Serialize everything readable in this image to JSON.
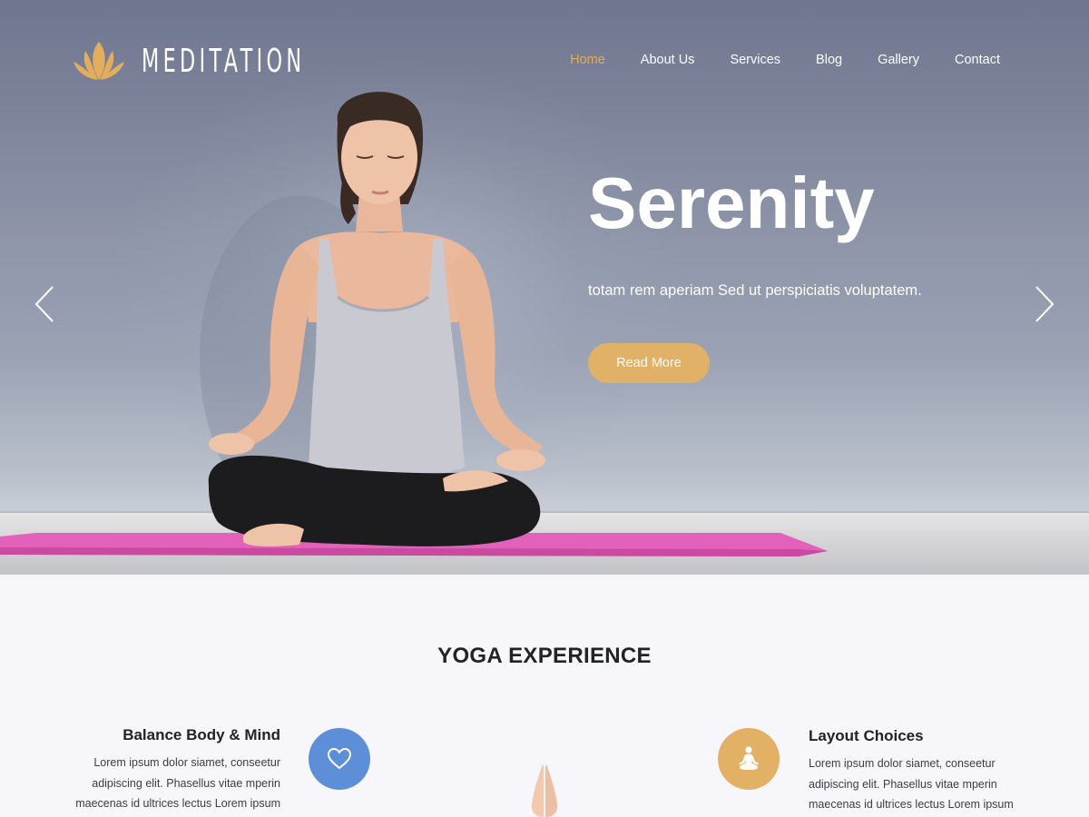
{
  "header": {
    "logo_text": "MEDITATION",
    "nav": [
      {
        "label": "Home",
        "active": true
      },
      {
        "label": "About Us",
        "active": false
      },
      {
        "label": "Services",
        "active": false
      },
      {
        "label": "Blog",
        "active": false
      },
      {
        "label": "Gallery",
        "active": false
      },
      {
        "label": "Contact",
        "active": false
      }
    ]
  },
  "hero": {
    "title": "Serenity",
    "subtitle": "totam rem aperiam Sed ut perspiciatis voluptatem.",
    "button_label": "Read More",
    "prev_icon": "chevron-left-icon",
    "next_icon": "chevron-right-icon"
  },
  "section": {
    "title": "YOGA EXPERIENCE",
    "features": [
      {
        "title": "Balance Body & Mind",
        "lines": [
          "Lorem ipsum dolor siamet, conseetur",
          "adipiscing elit. Phasellus vitae mperin",
          "maecenas id ultrices lectus Lorem ipsum"
        ],
        "icon": "heart-icon",
        "icon_color": "#5d8fd9"
      },
      {
        "title": "Layout Choices",
        "lines": [
          "Lorem ipsum dolor siamet, conseetur",
          "adipiscing elit. Phasellus vitae mperin",
          "maecenas id ultrices lectus Lorem ipsum"
        ],
        "icon": "meditation-icon",
        "icon_color": "#e2b166"
      }
    ]
  },
  "colors": {
    "accent": "#e0ad5e",
    "button": "#e1b167",
    "blue": "#5d8fd9",
    "mat": "#e05fb8"
  }
}
